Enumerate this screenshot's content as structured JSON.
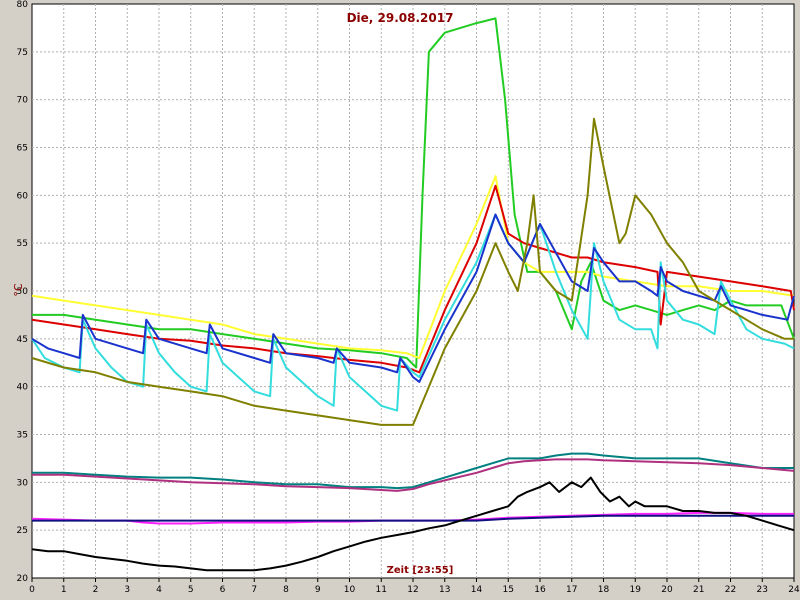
{
  "chart_data": {
    "type": "line",
    "title": "Die, 29.08.2017",
    "xlabel": "Zeit [23:55]",
    "ylabel": "°C",
    "xlim": [
      0,
      24
    ],
    "ylim": [
      20,
      80
    ],
    "x_ticks": [
      "0",
      "1",
      "2",
      "3",
      "4",
      "5",
      "6",
      "7",
      "8",
      "9",
      "10",
      "11",
      "12",
      "13",
      "14",
      "15",
      "16",
      "17",
      "18",
      "19",
      "20",
      "21",
      "22",
      "23",
      "24"
    ],
    "y_ticks": [
      "20",
      "25",
      "30",
      "35",
      "40",
      "45",
      "50",
      "55",
      "60",
      "65",
      "70",
      "75",
      "80"
    ],
    "grid": true,
    "series": [
      {
        "color": "#22cc22",
        "x": [
          0,
          1,
          2,
          3,
          4,
          5,
          6,
          7,
          8,
          9,
          10,
          11,
          11.8,
          12.1,
          12.3,
          12.5,
          13,
          14,
          14.6,
          14.9,
          15.2,
          15.6,
          16,
          16.5,
          17,
          17.3,
          17.6,
          18,
          18.5,
          19,
          19.5,
          20,
          20.5,
          21,
          21.5,
          22,
          22.5,
          23,
          23.6,
          24
        ],
        "y": [
          47.5,
          47.5,
          47,
          46.5,
          46,
          46,
          45.5,
          45,
          44.5,
          44,
          43.8,
          43.5,
          43,
          42,
          60,
          75,
          77,
          78,
          78.5,
          70,
          58,
          52,
          52,
          50,
          46,
          51,
          53,
          49,
          48,
          48.5,
          48,
          47.5,
          48,
          48.5,
          48,
          49,
          48.5,
          48.5,
          48.5,
          45
        ]
      },
      {
        "color": "#ffff33",
        "x": [
          0,
          1,
          2,
          3,
          4,
          5,
          6,
          7,
          8,
          9,
          10,
          11,
          11.8,
          12.2,
          13,
          14,
          14.6,
          15,
          15.5,
          16,
          16.5,
          17,
          17.5,
          18,
          19,
          20,
          21,
          22,
          23,
          24
        ],
        "y": [
          49.5,
          49,
          48.5,
          48,
          47.5,
          47,
          46.5,
          45.5,
          45,
          44.5,
          44,
          43.8,
          43.5,
          43,
          50,
          57,
          62,
          55,
          53,
          52,
          52,
          52,
          52,
          51.5,
          51,
          50.5,
          50.5,
          50,
          50,
          49.5
        ]
      },
      {
        "color": "#dd0000",
        "x": [
          0,
          1,
          2,
          3,
          4,
          5,
          6,
          7,
          8,
          9,
          10,
          11,
          11.8,
          12.2,
          13,
          14,
          14.6,
          15,
          15.5,
          16,
          16.5,
          17,
          17.5,
          18,
          19,
          19.7,
          19.8,
          20,
          21,
          22,
          23,
          23.9,
          24
        ],
        "y": [
          47,
          46.5,
          46,
          45.5,
          45,
          44.8,
          44.3,
          44,
          43.5,
          43.2,
          42.8,
          42.5,
          42,
          41.5,
          48,
          55,
          61,
          56,
          55,
          54.5,
          54,
          53.5,
          53.5,
          53,
          52.5,
          52,
          46.5,
          52,
          51.5,
          51,
          50.5,
          50,
          48
        ]
      },
      {
        "color": "#33dddd",
        "x": [
          0,
          0.4,
          1,
          1.5,
          1.6,
          2,
          2.5,
          3,
          3.5,
          3.6,
          4,
          4.5,
          5,
          5.5,
          5.6,
          6,
          6.5,
          7,
          7.5,
          7.6,
          8,
          8.5,
          9,
          9.5,
          9.6,
          10,
          10.5,
          11,
          11.5,
          11.6,
          12,
          12.2,
          13,
          14,
          14.6,
          15,
          15.5,
          16,
          16.5,
          17,
          17.5,
          17.7,
          18,
          18.5,
          19,
          19.5,
          19.7,
          19.8,
          20,
          20.5,
          21,
          21.5,
          21.7,
          22,
          22.5,
          23,
          23.7,
          24
        ],
        "y": [
          45,
          43,
          42,
          41.5,
          47,
          44,
          42,
          40.5,
          40,
          46.5,
          43.5,
          41.5,
          40,
          39.5,
          45.5,
          42.5,
          41,
          39.5,
          39,
          45,
          42,
          40.5,
          39,
          38,
          44,
          41,
          39.5,
          38,
          37.5,
          43,
          41.5,
          41,
          47,
          53,
          58,
          55,
          53,
          57,
          52,
          48,
          45,
          55,
          51,
          47,
          46,
          46,
          44,
          53,
          49,
          47,
          46.5,
          45.5,
          51,
          49,
          46,
          45,
          44.5,
          44
        ]
      },
      {
        "color": "#1a33cc",
        "x": [
          0,
          0.5,
          1,
          1.5,
          1.6,
          2,
          3,
          3.5,
          3.6,
          4,
          5,
          5.5,
          5.6,
          6,
          7,
          7.5,
          7.6,
          8,
          9,
          9.5,
          9.6,
          10,
          11,
          11.5,
          11.6,
          12,
          12.2,
          13,
          14,
          14.6,
          15,
          15.5,
          16,
          16.5,
          17,
          17.5,
          17.7,
          18,
          18.5,
          19,
          19.5,
          19.7,
          19.8,
          20,
          20.5,
          21,
          21.5,
          21.7,
          22,
          22.5,
          23,
          23.8,
          24
        ],
        "y": [
          45,
          44,
          43.5,
          43,
          47.5,
          45,
          44,
          43.5,
          47,
          45,
          44,
          43.5,
          46.5,
          44,
          43,
          42.5,
          45.5,
          43.5,
          43,
          42.5,
          44,
          42.5,
          42,
          41.5,
          43,
          41,
          40.5,
          46,
          52,
          58,
          55,
          53,
          57,
          54,
          51,
          50,
          54.5,
          53,
          51,
          51,
          50,
          49.5,
          52.5,
          51,
          50,
          49.5,
          49,
          50.5,
          48.5,
          48,
          47.5,
          47,
          49.5
        ]
      },
      {
        "color": "#808000",
        "x": [
          0,
          1,
          2,
          3,
          4,
          5,
          6,
          7,
          8,
          9,
          10,
          11,
          11.5,
          12,
          12.5,
          13,
          14,
          14.6,
          15,
          15.3,
          15.6,
          15.8,
          16,
          16.5,
          17,
          17.5,
          17.7,
          18,
          18.5,
          18.7,
          19,
          19.5,
          20,
          20.5,
          21,
          21.5,
          22,
          22.5,
          23,
          23.7,
          24
        ],
        "y": [
          43,
          42,
          41.5,
          40.5,
          40,
          39.5,
          39,
          38,
          37.5,
          37,
          36.5,
          36,
          36,
          36,
          40,
          44,
          50,
          55,
          52,
          50,
          55,
          60,
          52,
          50,
          49,
          60,
          68,
          63,
          55,
          56,
          60,
          58,
          55,
          53,
          50,
          49,
          48,
          47,
          46,
          45,
          45
        ]
      },
      {
        "color": "#008080",
        "x": [
          0,
          1,
          2,
          3,
          4,
          5,
          6,
          7,
          8,
          9,
          10,
          11,
          11.5,
          12,
          12.5,
          13,
          14,
          14.5,
          15,
          15.5,
          16,
          16.5,
          17,
          17.5,
          18,
          19,
          20,
          21,
          22,
          23,
          24
        ],
        "y": [
          31,
          31,
          30.8,
          30.6,
          30.5,
          30.5,
          30.3,
          30,
          29.8,
          29.8,
          29.5,
          29.5,
          29.4,
          29.5,
          30,
          30.5,
          31.5,
          32,
          32.5,
          32.5,
          32.5,
          32.8,
          33,
          33,
          32.8,
          32.5,
          32.5,
          32.5,
          32,
          31.5,
          31.5
        ]
      },
      {
        "color": "#b03080",
        "x": [
          0,
          1,
          2,
          3,
          4,
          5,
          6,
          7,
          8,
          9,
          10,
          11,
          11.5,
          12,
          12.5,
          13,
          14,
          14.5,
          15,
          15.5,
          16,
          16.5,
          17,
          17.5,
          18,
          19,
          20,
          21,
          22,
          23,
          24
        ],
        "y": [
          30.8,
          30.8,
          30.6,
          30.4,
          30.2,
          30,
          29.9,
          29.8,
          29.6,
          29.5,
          29.4,
          29.2,
          29.1,
          29.3,
          29.8,
          30.2,
          31,
          31.5,
          32,
          32.2,
          32.3,
          32.4,
          32.4,
          32.4,
          32.3,
          32.2,
          32.1,
          32,
          31.8,
          31.5,
          31.2
        ]
      },
      {
        "color": "#ff22ff",
        "x": [
          0,
          1,
          2,
          3,
          3.5,
          4,
          5,
          6,
          7,
          8,
          9,
          10,
          11,
          12,
          13,
          14,
          15,
          16,
          17,
          18,
          19,
          20,
          21,
          22,
          23,
          24
        ],
        "y": [
          26.2,
          26.1,
          26,
          26,
          25.8,
          25.7,
          25.7,
          25.8,
          25.8,
          25.8,
          25.9,
          25.9,
          26,
          26,
          26,
          26.1,
          26.3,
          26.4,
          26.5,
          26.6,
          26.7,
          26.7,
          26.8,
          26.8,
          26.7,
          26.7
        ]
      },
      {
        "color": "#101080",
        "x": [
          0,
          1,
          2,
          3,
          4,
          5,
          6,
          7,
          8,
          9,
          10,
          11,
          12,
          13,
          14,
          15,
          16,
          17,
          18,
          19,
          20,
          21,
          22,
          23,
          24
        ],
        "y": [
          26,
          26,
          26,
          26,
          26,
          26,
          26,
          26,
          26,
          26,
          26,
          26,
          26,
          26,
          26,
          26.2,
          26.3,
          26.4,
          26.5,
          26.5,
          26.5,
          26.5,
          26.5,
          26.5,
          26.5
        ]
      },
      {
        "color": "#000000",
        "x": [
          0,
          0.5,
          1,
          1.5,
          2,
          2.5,
          3,
          3.5,
          4,
          4.5,
          5,
          5.5,
          6,
          6.5,
          7,
          7.5,
          8,
          8.5,
          9,
          9.5,
          10,
          10.5,
          11,
          11.5,
          12,
          12.5,
          13,
          13.5,
          14,
          14.5,
          15,
          15.3,
          15.6,
          16,
          16.3,
          16.6,
          17,
          17.3,
          17.6,
          17.9,
          18.2,
          18.5,
          18.8,
          19,
          19.3,
          19.6,
          20,
          20.5,
          21,
          21.5,
          22,
          22.5,
          23,
          23.5,
          24
        ],
        "y": [
          23,
          22.8,
          22.8,
          22.5,
          22.2,
          22,
          21.8,
          21.5,
          21.3,
          21.2,
          21,
          20.8,
          20.8,
          20.8,
          20.8,
          21,
          21.3,
          21.7,
          22.2,
          22.8,
          23.3,
          23.8,
          24.2,
          24.5,
          24.8,
          25.2,
          25.5,
          26,
          26.5,
          27,
          27.5,
          28.5,
          29,
          29.5,
          30,
          29,
          30,
          29.5,
          30.5,
          29,
          28,
          28.5,
          27.5,
          28,
          27.5,
          27.5,
          27.5,
          27,
          27,
          26.8,
          26.8,
          26.5,
          26,
          25.5,
          25
        ]
      }
    ]
  }
}
